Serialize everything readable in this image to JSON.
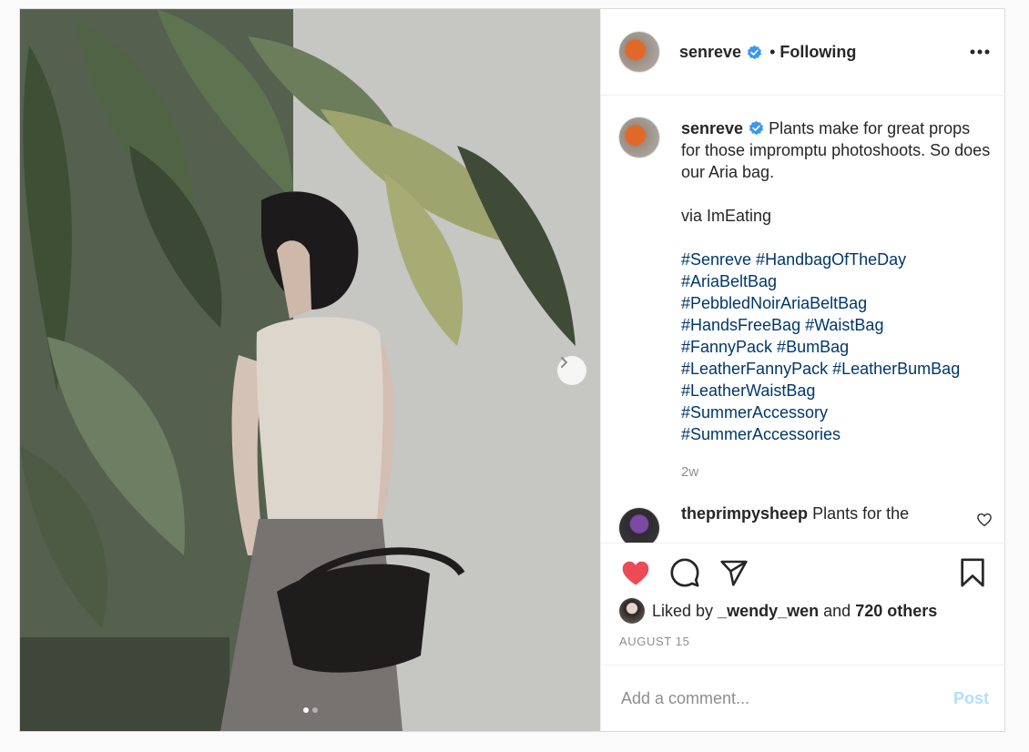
{
  "media": {
    "photo_description_icon": "photo-of-woman-with-leather-belt-bag-among-banana-leaves",
    "next_icon": "chevron-right-icon",
    "slides_total": 2,
    "slide_active": 1
  },
  "header": {
    "username": "senreve",
    "verified_icon": "verified-badge-icon",
    "bullet": "•",
    "follow_status": "Following",
    "more_icon": "more-horizontal-icon"
  },
  "caption": {
    "username": "senreve",
    "text": "Plants make for great props for those impromptu photoshoots. So does our Aria bag.\n\nvia ImEating",
    "hashtags": [
      "#Senreve #HandbagOfTheDay",
      "#AriaBeltBag",
      "#PebbledNoirAriaBeltBag",
      "#HandsFreeBag #WaistBag",
      "#FannyPack #BumBag",
      "#LeatherFannyPack #LeatherBumBag",
      "#LeatherWaistBag",
      "#SummerAccessory",
      "#SummerAccessories"
    ],
    "age": "2w"
  },
  "comment": {
    "username": "theprimpysheep",
    "text": "Plants for the"
  },
  "actions": {
    "like_icon": "heart-filled-icon",
    "comment_icon": "comment-bubble-icon",
    "share_icon": "paper-plane-icon",
    "save_icon": "bookmark-icon",
    "liked_prefix": "Liked by",
    "liked_user": "_wendy_wen",
    "liked_and": "and",
    "liked_others": "720 others",
    "date": "AUGUST 15"
  },
  "add_comment": {
    "placeholder": "Add a comment...",
    "post_label": "Post"
  },
  "colors": {
    "like_red": "#ed4956",
    "hashtag_blue": "#00376b",
    "verified_blue": "#3897f0",
    "post_disabled": "#b2dffc"
  }
}
